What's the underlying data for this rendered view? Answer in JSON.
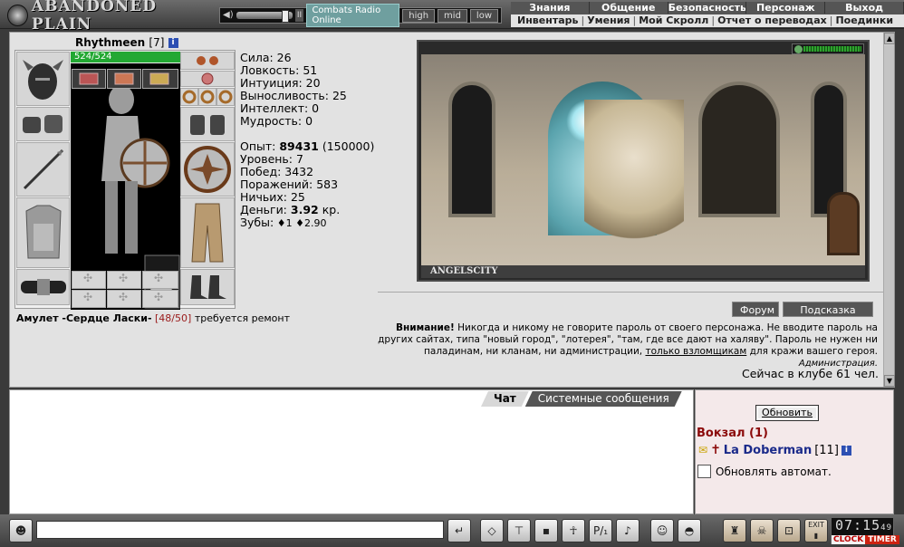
{
  "top": {
    "logo": "ABANDONED PLAIN",
    "radio": {
      "station": "Combats Radio Online",
      "q_high": "high",
      "q_mid": "mid",
      "q_low": "low"
    }
  },
  "menu": {
    "main": [
      "Знания",
      "Общение",
      "Безопасность",
      "Персонаж",
      "Выход"
    ],
    "sub": [
      "Инвентарь",
      "Умения",
      "Мой Скролл",
      "Отчет о переводах",
      "Поединки"
    ]
  },
  "character": {
    "name": "Rhythmeen",
    "level": "[7]",
    "info_glyph": "i",
    "hp": "524/524",
    "amulet": {
      "name": "Амулет -Сердце Ласки-",
      "durability": "[48/50]",
      "note": "требуется ремонт"
    }
  },
  "stats": {
    "lines1": [
      "Сила: 26",
      "Ловкость: 51",
      "Интуиция: 20",
      "Выносливость: 25",
      "Интеллект: 0",
      "Мудрость: 0"
    ],
    "exp_label": "Опыт:",
    "exp": "89431",
    "exp_next": "(150000)",
    "lines2": [
      "Уровень: 7",
      "Побед: 3432",
      "Поражений: 583",
      "Ничьих: 25"
    ],
    "money_label": "Деньги:",
    "money": "3.92",
    "money_unit": "кр.",
    "teeth_label": "Зубы:",
    "teeth_a": "1",
    "teeth_b": "2.90"
  },
  "scene": {
    "caption": "ANGELSCITY"
  },
  "buttons": {
    "forum": "Форум",
    "hint": "Подсказка"
  },
  "warning": {
    "bold": "Внимание!",
    "text1": " Никогда и никому не говорите пароль от своего персонажа. Не вводите пароль на других сайтах, типа \"новый город\", \"лотерея\", \"там, где все дают на халяву\". Пароль не нужен ни паладинам, ни кланам, ни администрации, ",
    "link": "только взломщикам",
    "text2": " для кражи вашего героя.",
    "signature": "Администрация."
  },
  "online": "Сейчас в клубе 61 чел.",
  "chat": {
    "tab_chat": "Чат",
    "tab_system": "Системные сообщения"
  },
  "side": {
    "refresh": "Обновить",
    "room": "Вокзал (1)",
    "user_name": "La Doberman",
    "user_level": "[11]",
    "auto": "Обновлять автомат."
  },
  "bottom": {
    "clock": {
      "time": "07:15",
      "sec": "49",
      "label_clock": "CLOCK",
      "label_timer": "TIMER"
    },
    "exit_label": "EXIT"
  }
}
